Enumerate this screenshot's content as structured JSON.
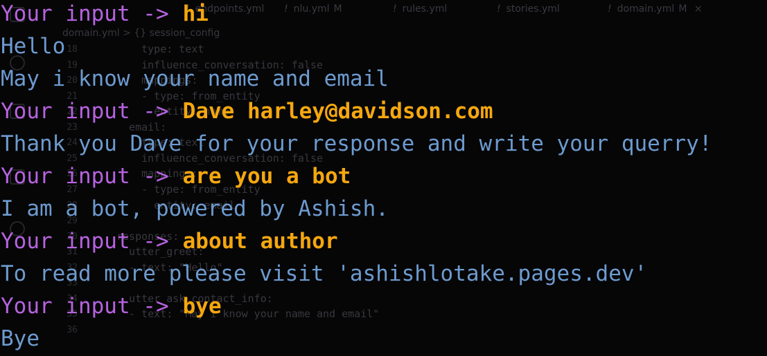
{
  "editor": {
    "tabs": [
      {
        "label": "endpoints.yml",
        "modified": ""
      },
      {
        "label": "nlu.yml",
        "modified": "M"
      },
      {
        "label": "rules.yml",
        "modified": ""
      },
      {
        "label": "stories.yml",
        "modified": ""
      },
      {
        "label": "domain.yml",
        "modified": "M",
        "close": "×"
      }
    ],
    "breadcrumb": "domain.yml > {} session_config",
    "lines": [
      {
        "num": "18",
        "code": "    type: text"
      },
      {
        "num": "19",
        "code": "    influence_conversation: false"
      },
      {
        "num": "20",
        "code": "    mappings:"
      },
      {
        "num": "21",
        "code": "    - type: from_entity"
      },
      {
        "num": "22",
        "code": "      entity: name"
      },
      {
        "num": "23",
        "code": "  email:"
      },
      {
        "num": "24",
        "code": "    type: text"
      },
      {
        "num": "25",
        "code": "    influence_conversation: false"
      },
      {
        "num": "26",
        "code": "    mappings:"
      },
      {
        "num": "27",
        "code": "    - type: from_entity"
      },
      {
        "num": "28",
        "code": "      entity: email"
      },
      {
        "num": "29",
        "code": ""
      },
      {
        "num": "30",
        "code": "responses:"
      },
      {
        "num": "31",
        "code": "  utter_greet:"
      },
      {
        "num": "32",
        "code": "  - text: \"Hello\""
      },
      {
        "num": "33",
        "code": ""
      },
      {
        "num": "34",
        "code": "  utter_ask_contact_info:"
      },
      {
        "num": "35",
        "code": "  - text: \"May i know your name and email\""
      },
      {
        "num": "36",
        "code": ""
      }
    ]
  },
  "terminal": {
    "prompt": "Your input ->",
    "lines": [
      {
        "kind": "input",
        "text": "hi"
      },
      {
        "kind": "response",
        "text": "Hello"
      },
      {
        "kind": "response",
        "text": "May i know your name and email"
      },
      {
        "kind": "input",
        "text": "Dave harley@davidson.com"
      },
      {
        "kind": "response",
        "text": "Thank you Dave for your response and write your querry!"
      },
      {
        "kind": "input",
        "text": "are you a bot"
      },
      {
        "kind": "response",
        "text": "I am a bot, powered by Ashish."
      },
      {
        "kind": "input",
        "text": "about author"
      },
      {
        "kind": "response",
        "text": "To read more please visit 'ashishlotake.pages.dev'"
      },
      {
        "kind": "input",
        "text": "bye"
      },
      {
        "kind": "response",
        "text": "Bye"
      }
    ]
  },
  "colors": {
    "background": "#060607",
    "prompt": "#b763e0",
    "user_input": "#f5a70f",
    "bot_response": "#6d9bcf"
  }
}
